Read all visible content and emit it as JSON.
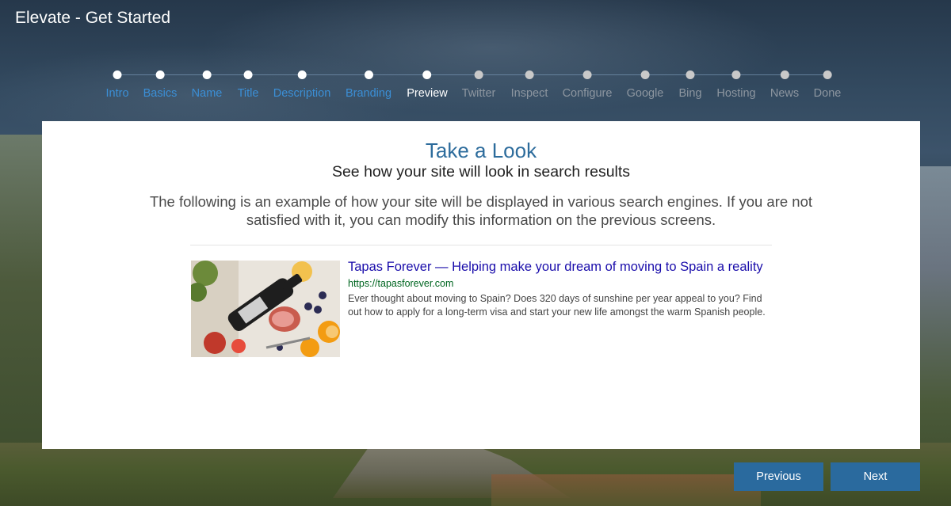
{
  "app": {
    "title": "Elevate - Get Started"
  },
  "steps": [
    {
      "label": "Intro",
      "state": "done"
    },
    {
      "label": "Basics",
      "state": "done"
    },
    {
      "label": "Name",
      "state": "done"
    },
    {
      "label": "Title",
      "state": "done"
    },
    {
      "label": "Description",
      "state": "done"
    },
    {
      "label": "Branding",
      "state": "done"
    },
    {
      "label": "Preview",
      "state": "current"
    },
    {
      "label": "Twitter",
      "state": "todo"
    },
    {
      "label": "Inspect",
      "state": "todo"
    },
    {
      "label": "Configure",
      "state": "todo"
    },
    {
      "label": "Google",
      "state": "todo"
    },
    {
      "label": "Bing",
      "state": "todo"
    },
    {
      "label": "Hosting",
      "state": "todo"
    },
    {
      "label": "News",
      "state": "todo"
    },
    {
      "label": "Done",
      "state": "todo"
    }
  ],
  "card": {
    "heading": "Take a Look",
    "subheading": "See how your site will look in search results",
    "description": "The following is an example of how your site will be displayed in various search engines. If you are not satisfied with it, you can modify this information on the previous screens.",
    "result": {
      "title": "Tapas Forever — Helping make your dream of moving to Spain a reality",
      "url": "https://tapasforever.com",
      "snippet": "Ever thought about moving to Spain? Does 320 days of sunshine per year appeal to you? Find out how to apply for a long-term visa and start your new life amongst the warm Spanish people."
    }
  },
  "nav": {
    "previous_label": "Previous",
    "next_label": "Next"
  },
  "colors": {
    "step_done": "#3b8fd6",
    "step_current": "#ffffff",
    "step_todo": "#8d96a0",
    "heading": "#2d6c9c",
    "button": "#2a6a9e",
    "result_title": "#1a0dab",
    "result_url": "#006621"
  }
}
